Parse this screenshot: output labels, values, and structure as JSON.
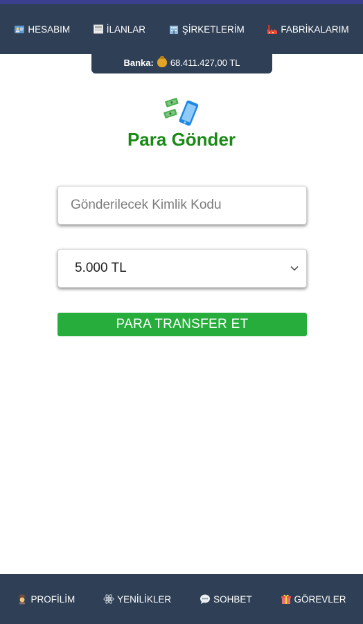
{
  "top_nav": {
    "items": [
      {
        "label": "HESABIM",
        "icon": "id-card-icon"
      },
      {
        "label": "İLANLAR",
        "icon": "newspaper-icon"
      },
      {
        "label": "ŞİRKETLERİM",
        "icon": "office-building-icon"
      },
      {
        "label": "FABRİKALARIM",
        "icon": "factory-icon"
      }
    ]
  },
  "bank": {
    "label": "Banka:",
    "icon": "money-bag-icon",
    "value": "68.411.427,00 TL"
  },
  "main": {
    "icon": "money-phone-icon",
    "title": "Para Gönder",
    "id_input": {
      "value": "",
      "placeholder": "Gönderilecek Kimlik Kodu"
    },
    "amount_select": {
      "selected": "5.000 TL"
    },
    "submit_label": "PARA TRANSFER ET"
  },
  "bottom_nav": {
    "items": [
      {
        "label": "PROFİLİM",
        "icon": "detective-icon"
      },
      {
        "label": "YENİLİKLER",
        "icon": "atom-icon"
      },
      {
        "label": "SOHBET",
        "icon": "speech-bubble-icon"
      },
      {
        "label": "GÖREVLER",
        "icon": "gift-icon"
      }
    ]
  },
  "colors": {
    "nav_bg": "#2f4056",
    "title_green": "#1a8a16",
    "button_green": "#27ad3c"
  }
}
